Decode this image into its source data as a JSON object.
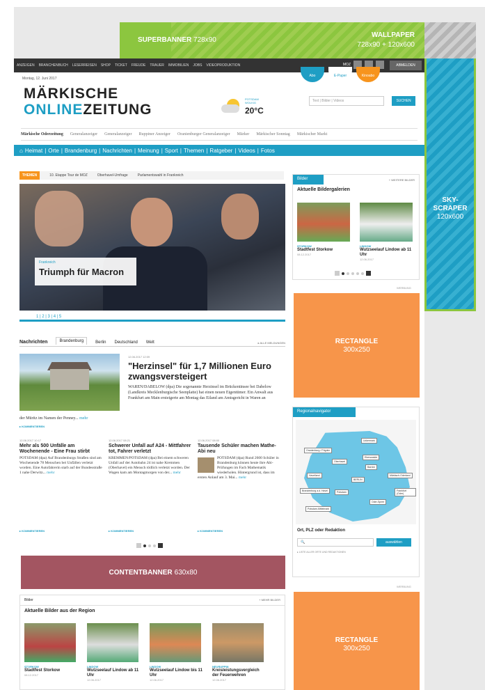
{
  "ads": {
    "superbanner": {
      "label": "SUPERBANNER",
      "size": "728x90"
    },
    "wallpaper": {
      "label": "WALLPAPER",
      "size": "728x90 + 120x600"
    },
    "skyscraper": {
      "label1": "SKY-",
      "label2": "SCRAPER",
      "size": "120x600"
    },
    "rectangle": {
      "label": "RECTANGLE",
      "size": "300x250"
    },
    "contentbanner": {
      "label": "CONTENTBANNER",
      "size": "630x80"
    },
    "werbung": "WERBUNG"
  },
  "topnav": {
    "items": [
      "ANZEIGEN",
      "BRANCHENBUCH",
      "LESERREISEN",
      "SHOP",
      "TICKET",
      "FREUDE",
      "TRAUER",
      "IMMOBILIEN",
      "JOBS",
      "VIDEOPRODUKTION"
    ],
    "moz": "MOZ",
    "abo": "ABMELDEN"
  },
  "header": {
    "date": "Montag, 12. Juni 2017",
    "logo_line1": "MÄRKISCHE",
    "logo_online": "ONLINE",
    "logo_zeitung": "ZEITUNG",
    "circles": [
      "Abo",
      "E-Paper",
      "Kinoabo"
    ],
    "weather": {
      "place": "POTSDAM",
      "cond": "WOLKIG",
      "temp": "20°C"
    },
    "search_placeholder": "Text | Bilder | Videos",
    "search_button": "SUCHEN"
  },
  "papers": [
    "Märkische Oderzeitung",
    "Generalanzeiger",
    "Generalanzeiger",
    "Ruppiner Anzeiger",
    "Oranienburger Generalanzeiger",
    "Märker",
    "Märkischer Sonntag",
    "Märkischer Markt"
  ],
  "mainnav": [
    "Heimat",
    "Orte",
    "Brandenburg",
    "Nachrichten",
    "Meinung",
    "Sport",
    "Themen",
    "Ratgeber",
    "Videos",
    "Fotos"
  ],
  "themen": {
    "tag": "THEMEN",
    "items": [
      "10. Etappe Tour de MOZ",
      "Oberhavel-Umfrage",
      "Parlamentswahl in Frankreich"
    ]
  },
  "hero": {
    "kicker": "Frankreich",
    "title": "Triumph für Macron",
    "pager": "1 | 2 | 3 | 4 | 5"
  },
  "news": {
    "tabs": [
      "Nachrichten",
      "Brandenburg",
      "Berlin",
      "Deutschland",
      "Welt"
    ],
    "more": "▸ ALLE MELDUNGEN",
    "lead": {
      "meta": "12.06.2017 12:09",
      "title": "\"Herzinsel\" für 1,7 Millionen Euro zwangsversteigert",
      "text": "WAREN/DABELOW (dpa) Die sogenannte Herzinsel im Brückentinsee bei Dabelow (Landkreis Mecklenburgische Seenplatte) hat einen neuen Eigentümer. Ein Anwalt aus Frankfurt am Main ersteigerte am Montag das Eiland am Amtsgericht in Waren an",
      "text2": "der Müritz im Namen der Penney...",
      "mehr": "mehr",
      "komm": "KOMMENTIEREN"
    },
    "cols": [
      {
        "meta": "12.06.2017 10:17",
        "title": "Mehr als 500 Unfälle am Wochenende - Eine Frau stirbt",
        "text": "POTSDAM (dpa) Auf Brandenburgs Straßen sind am Wochenende 78 Menschen bei Unfällen verletzt worden. Eine Autofahrerin starb auf der Bundesstraße 1 nahe Derwitz...",
        "mehr": "mehr",
        "komm": "KOMMENTIEREN"
      },
      {
        "meta": "12.06.2017 08:21",
        "title": "Schwerer Unfall auf A24 - Mittfahrer tot, Fahrer verletzt",
        "text": "KREMMEN/POTSDAM (dpa) Bei einem schweren Unfall auf der Autobahn 24 ist nahe Kremmen (Oberhavel) ein Mensch tödlich verletzt worden. Der Wagen kam am Montagmorgen von der...",
        "mehr": "mehr",
        "komm": "KOMMENTIEREN"
      },
      {
        "meta": "12.06.2017 08:00",
        "title": "Tausende Schüler machen Mathe-Abi neu",
        "text": "POTSDAM (dpa) Rund 2600 Schüler in Brandenburg können heute ihre Abi-Prüfungen im Fach Mathematik wiederholen. Hintergrund ist, dass im ersten Anlauf am 3. Mai...",
        "mehr": "mehr",
        "komm": "KOMMENTIEREN"
      }
    ]
  },
  "bilder_bottom": {
    "head": "Bilder",
    "more": "+ MEHR BILDER",
    "title": "Aktuelle Bilder aus der Region",
    "items": [
      {
        "cat": "STORKOW",
        "name": "Stadtfest Storkow",
        "date": "08.12.2017"
      },
      {
        "cat": "LINDOW",
        "name": "Wutzseelauf Lindow ab 11 Uhr",
        "date": "12.06.2017"
      },
      {
        "cat": "LINDOW",
        "name": "Wutzseelauf Lindow bis 11 Uhr",
        "date": "12.06.2017"
      },
      {
        "cat": "NEURUPPIN",
        "name": "Kreisleistungsvergleich der Feuerwehren",
        "date": "12.06.2017"
      }
    ]
  },
  "bilder_right": {
    "head": "Bilder",
    "more": "+ WEITERE BILDER",
    "title": "Aktuelle Bildergalerien",
    "items": [
      {
        "cat": "STORKOW",
        "name": "Stadtfest Storkow",
        "date": "08.12.2017"
      },
      {
        "cat": "LINDOW",
        "name": "Wutzseelauf Lindow ab 11 Uhr",
        "date": "12.06.2017"
      }
    ]
  },
  "regionalnav": {
    "head": "Regionalnavigator",
    "regions": [
      "Uckermark",
      "Oranienburg / Prignitz",
      "Eberswalde",
      "Oberhavel",
      "Barnim",
      "Havelland",
      "BERLIN",
      "Märkisch-Oderland",
      "Brandenburg a.d. Havel",
      "Potsdam",
      "Frankfurt (Oder)",
      "Oder-Spree",
      "Potsdam-Mittelmark"
    ],
    "ort_label": "Ort, PLZ oder Redaktion",
    "button": "auswählen",
    "note": "▸ LISTE ALLER ORTE UND REDAKTIONEN"
  }
}
